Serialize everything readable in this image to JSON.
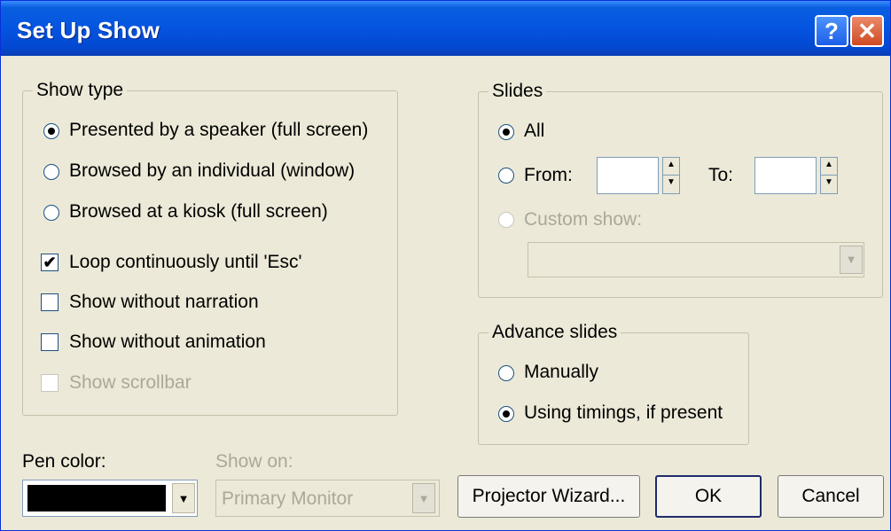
{
  "window": {
    "title": "Set Up Show",
    "help_glyph": "?",
    "close_glyph": "✕"
  },
  "show_type": {
    "legend": "Show type",
    "options": [
      {
        "label": "Presented by a speaker (full screen)",
        "selected": true
      },
      {
        "label": "Browsed by an individual (window)",
        "selected": false
      },
      {
        "label": "Browsed at a kiosk (full screen)",
        "selected": false
      }
    ],
    "checks": [
      {
        "label": "Loop continuously until 'Esc'",
        "checked": true,
        "enabled": true
      },
      {
        "label": "Show without narration",
        "checked": false,
        "enabled": true
      },
      {
        "label": "Show without animation",
        "checked": false,
        "enabled": true
      },
      {
        "label": "Show scrollbar",
        "checked": false,
        "enabled": false
      }
    ]
  },
  "slides": {
    "legend": "Slides",
    "all_label": "All",
    "from_label": "From:",
    "to_label": "To:",
    "from_value": "",
    "to_value": "",
    "custom_label": "Custom show:",
    "custom_value": "",
    "selected": "All"
  },
  "advance": {
    "legend": "Advance slides",
    "manually_label": "Manually",
    "timings_label": "Using timings, if present",
    "selected": "Using timings, if present"
  },
  "pen": {
    "label": "Pen color:",
    "color": "#000000"
  },
  "show_on": {
    "label": "Show on:",
    "value": "Primary Monitor"
  },
  "buttons": {
    "projector": "Projector Wizard...",
    "ok": "OK",
    "cancel": "Cancel"
  },
  "icons": {
    "dropdown_arrow": "▼",
    "spin_up": "▲",
    "spin_down": "▼",
    "check_mark": "✔"
  }
}
